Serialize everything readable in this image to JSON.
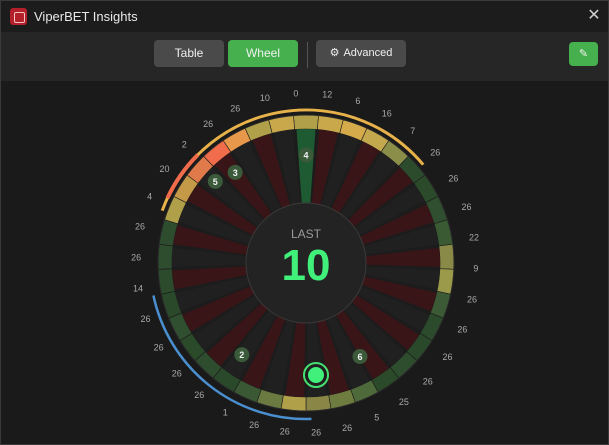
{
  "window": {
    "title": "ViperBET Insights",
    "close_glyph": "✕",
    "app_icon": "viperbet-logo-icon"
  },
  "toolbar": {
    "table_label": "Table",
    "wheel_label": "Wheel",
    "advanced_label": "Advanced",
    "advanced_icon": "gear-icon",
    "pin_icon": "pin-icon",
    "pin_glyph": "✎",
    "active_view": "Wheel"
  },
  "wheel": {
    "center_label": "LAST",
    "center_value": "10",
    "outer_numbers": [
      "10",
      "0",
      "12",
      "6",
      "16",
      "7",
      "26",
      "26",
      "26",
      "22",
      "9",
      "26",
      "26",
      "26",
      "26",
      "25",
      "5",
      "26",
      "26",
      "26",
      "26",
      "1",
      "26",
      "26",
      "26",
      "26",
      "14",
      "26",
      "26",
      "4",
      "20",
      "2",
      "26",
      "26"
    ],
    "slot_badges": [
      "4",
      "3",
      "5",
      "2",
      "6"
    ],
    "colors": {
      "accent": "#46b04e",
      "highlight": "#2fe873",
      "hot": "#e8b24a",
      "hottest": "#f06c4a",
      "cold_arc": "#4a8fd0",
      "red_pocket": "#3a1518",
      "black_pocket": "#202020",
      "zero_pocket": "#1e5a32"
    }
  }
}
